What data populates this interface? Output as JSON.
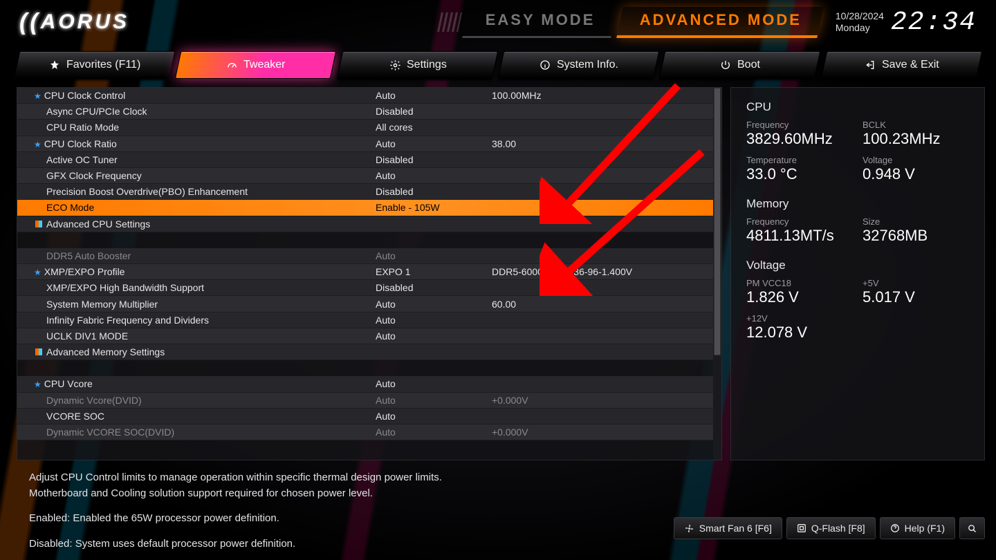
{
  "brand": "AORUS",
  "modes": {
    "easy": "EASY MODE",
    "advanced": "ADVANCED MODE"
  },
  "clock": {
    "date": "10/28/2024",
    "day": "Monday",
    "time": "22:34"
  },
  "nav": {
    "favorites": "Favorites (F11)",
    "tweaker": "Tweaker",
    "settings": "Settings",
    "system_info": "System Info.",
    "boot": "Boot",
    "save_exit": "Save & Exit"
  },
  "rows": [
    {
      "label": "CPU Clock Control",
      "value": "Auto",
      "extra": "100.00MHz",
      "star": true
    },
    {
      "label": "Async CPU/PCIe Clock",
      "value": "Disabled"
    },
    {
      "label": "CPU Ratio Mode",
      "value": "All cores"
    },
    {
      "label": "CPU Clock Ratio",
      "value": "Auto",
      "extra": "38.00",
      "star": true
    },
    {
      "label": "Active OC Tuner",
      "value": "Disabled"
    },
    {
      "label": "GFX Clock Frequency",
      "value": "Auto"
    },
    {
      "label": "Precision Boost Overdrive(PBO) Enhancement",
      "value": "Disabled"
    },
    {
      "label": "ECO Mode",
      "value": "Enable - 105W",
      "highlight": true
    },
    {
      "label": "Advanced CPU Settings",
      "submenu": true
    },
    {
      "gap": true
    },
    {
      "label": "DDR5 Auto Booster",
      "value": "Auto",
      "dim": true
    },
    {
      "label": "XMP/EXPO Profile",
      "value": "EXPO 1",
      "extra": "DDR5-6000 28-36-36-96-1.400V",
      "star": true
    },
    {
      "label": "XMP/EXPO High Bandwidth Support",
      "value": "Disabled"
    },
    {
      "label": "System Memory Multiplier",
      "value": "Auto",
      "extra": "60.00"
    },
    {
      "label": "Infinity Fabric Frequency and Dividers",
      "value": "Auto"
    },
    {
      "label": "UCLK DIV1 MODE",
      "value": "Auto"
    },
    {
      "label": "Advanced Memory Settings",
      "submenu": true
    },
    {
      "gap": true
    },
    {
      "label": "CPU Vcore",
      "value": "Auto",
      "star": true
    },
    {
      "label": "Dynamic Vcore(DVID)",
      "value": "Auto",
      "extra": "+0.000V",
      "dim": true
    },
    {
      "label": "VCORE SOC",
      "value": "Auto"
    },
    {
      "label": "Dynamic VCORE SOC(DVID)",
      "value": "Auto",
      "extra": "+0.000V",
      "dim": true
    }
  ],
  "side": {
    "cpu": {
      "title": "CPU",
      "freq_label": "Frequency",
      "freq": "3829.60MHz",
      "bclk_label": "BCLK",
      "bclk": "100.23MHz",
      "temp_label": "Temperature",
      "temp": "33.0 °C",
      "volt_label": "Voltage",
      "volt": "0.948 V"
    },
    "memory": {
      "title": "Memory",
      "freq_label": "Frequency",
      "freq": "4811.13MT/s",
      "size_label": "Size",
      "size": "32768MB"
    },
    "voltage": {
      "title": "Voltage",
      "a_label": "PM VCC18",
      "a": "1.826 V",
      "b_label": "+5V",
      "b": "5.017 V",
      "c_label": "+12V",
      "c": "12.078 V"
    }
  },
  "help": {
    "l1": "Adjust CPU Control limits to manage operation within specific thermal design power limits.",
    "l2": " Motherboard and Cooling solution support required for chosen power level.",
    "l3": "Enabled: Enabled the 65W processor power definition.",
    "l4": "Disabled: System uses default processor power definition."
  },
  "footer": {
    "smartfan": "Smart Fan 6 [F6]",
    "qflash": "Q-Flash [F8]",
    "help": "Help (F1)"
  }
}
